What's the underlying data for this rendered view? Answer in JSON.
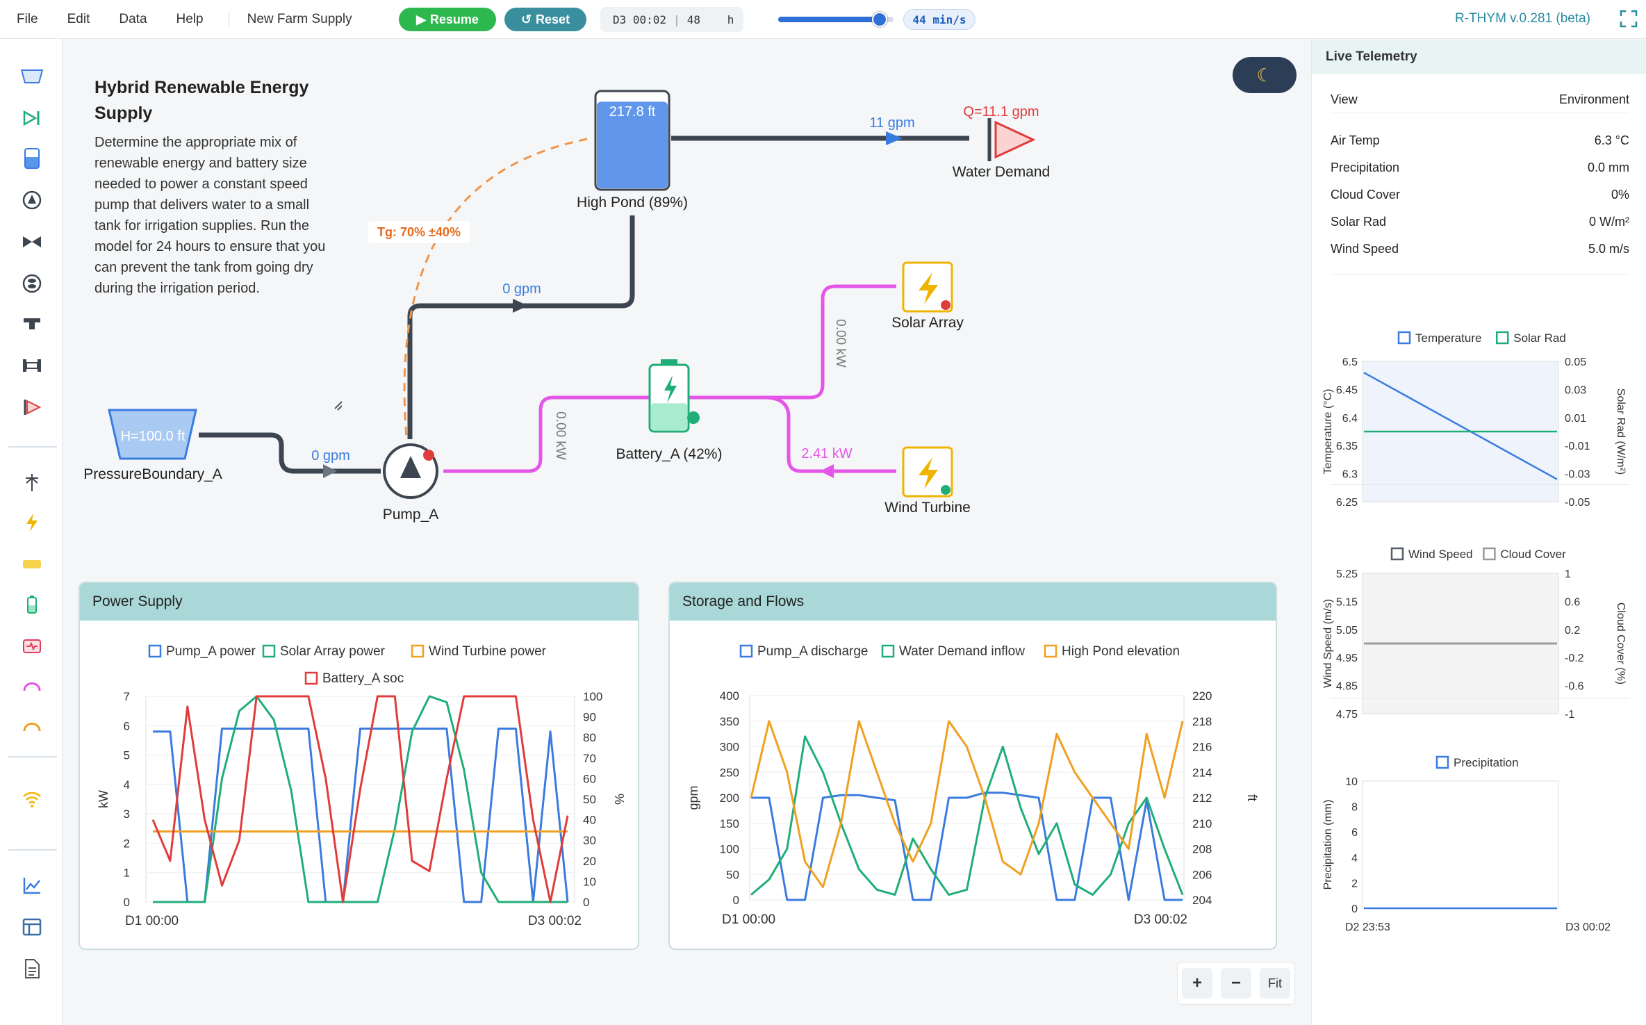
{
  "menu": {
    "file": "File",
    "edit": "Edit",
    "data": "Data",
    "help": "Help"
  },
  "model_name": "New Farm Supply",
  "controls": {
    "resume": "Resume",
    "reset": "Reset",
    "clock": "D3 00:02",
    "duration": "48",
    "duration_unit": "h",
    "speed": "44 min/s",
    "speed_fraction": 0.88
  },
  "version": "R-THYM v.0.281 (beta)",
  "description": {
    "title": "Hybrid Renewable Energy Supply",
    "body": "Determine the appropriate mix of renewable energy and battery size needed to power a constant speed pump that delivers water to a small tank for irrigation supplies. Run the model for 24 hours to ensure that you can prevent the tank from going dry during the irrigation period."
  },
  "schematic": {
    "pressure_boundary": {
      "name": "PressureBoundary_A",
      "head": "H=100.0 ft"
    },
    "pump": {
      "name": "Pump_A"
    },
    "pond": {
      "name": "High Pond (89%)",
      "level": "217.8 ft",
      "fill": 0.89
    },
    "battery": {
      "name": "Battery_A (42%)",
      "fill": 0.42
    },
    "solar": {
      "name": "Solar Array"
    },
    "wind": {
      "name": "Wind Turbine"
    },
    "demand": {
      "name": "Water Demand",
      "q": "Q=11.1 gpm"
    },
    "flows": {
      "inlet": "0 gpm",
      "pump_out": "0 gpm",
      "demand": "11 gpm",
      "solar_kw": "0.00 kW",
      "battery_kw": "0.00 kW",
      "wind_kw": "2.41 kW"
    },
    "target": "Tg: 70% ±40%"
  },
  "power_panel": {
    "title": "Power Supply",
    "legend": [
      "Pump_A power",
      "Solar Array power",
      "Wind Turbine power",
      "Battery_A soc"
    ],
    "y_left_ticks": [
      "7",
      "6",
      "5",
      "4",
      "3",
      "2",
      "1",
      "0"
    ],
    "y_right_ticks": [
      "100",
      "90",
      "80",
      "70",
      "60",
      "50",
      "40",
      "30",
      "20",
      "10",
      "0"
    ],
    "y_left_label": "kW",
    "y_right_label": "%",
    "x_start": "D1 00:00",
    "x_end": "D3 00:02"
  },
  "storage_panel": {
    "title": "Storage and Flows",
    "legend": [
      "Pump_A discharge",
      "Water Demand inflow",
      "High Pond elevation"
    ],
    "y_left_ticks": [
      "400",
      "350",
      "300",
      "250",
      "200",
      "150",
      "100",
      "50",
      "0"
    ],
    "y_right_ticks": [
      "220",
      "218",
      "216",
      "214",
      "212",
      "210",
      "208",
      "206",
      "204"
    ],
    "y_left_label": "gpm",
    "y_right_label": "ft",
    "x_start": "D1 00:00",
    "x_end": "D3 00:02"
  },
  "telemetry": {
    "title": "Live Telemetry",
    "view_label": "View",
    "view_value": "Environment",
    "rows": [
      {
        "label": "Air Temp",
        "value": "6.3 °C"
      },
      {
        "label": "Precipitation",
        "value": "0.0 mm"
      },
      {
        "label": "Cloud Cover",
        "value": "0%"
      },
      {
        "label": "Solar Rad",
        "value": "0 W/m²"
      },
      {
        "label": "Wind Speed",
        "value": "5.0 m/s"
      }
    ],
    "chart1": {
      "legend": [
        "Temperature",
        "Solar Rad"
      ],
      "y_left": [
        "6.5",
        "6.45",
        "6.4",
        "6.35",
        "6.3",
        "6.25"
      ],
      "y_right": [
        "0.05",
        "0.03",
        "0.01",
        "-0.01",
        "-0.03",
        "-0.05"
      ],
      "y_left_label": "Temperature (°C)",
      "y_right_label": "Solar Rad (W/m²)"
    },
    "chart2": {
      "legend": [
        "Wind Speed",
        "Cloud Cover"
      ],
      "y_left": [
        "5.25",
        "5.15",
        "5.05",
        "4.95",
        "4.85",
        "4.75"
      ],
      "y_right": [
        "1",
        "0.6",
        "0.2",
        "-0.2",
        "-0.6",
        "-1"
      ],
      "y_left_label": "Wind Speed (m/s)",
      "y_right_label": "Cloud Cover (%)"
    },
    "chart3": {
      "legend": [
        "Precipitation"
      ],
      "y_left": [
        "10",
        "8",
        "6",
        "4",
        "2",
        "0"
      ],
      "y_left_label": "Precipitation (mm)",
      "x_start": "D2 23:53",
      "x_end": "D3 00:02"
    }
  },
  "zoom": {
    "plus": "+",
    "minus": "−",
    "fit": "Fit"
  },
  "colors": {
    "pump_power": "#3a7be0",
    "solar_power": "#1fae78",
    "wind_power": "#f0a020",
    "battery_soc": "#e03c3c",
    "pipe": "#3d4550",
    "power_line": "#e455e8",
    "brand_green": "#2db84d",
    "brand_teal": "#3a8f9f"
  },
  "chart_data": [
    {
      "type": "line",
      "title": "Power Supply",
      "x_range": [
        "D1 00:00",
        "D3 00:02"
      ],
      "ylim_left": [
        0,
        7
      ],
      "ylim_right": [
        0,
        100
      ],
      "series": [
        {
          "name": "Pump_A power",
          "axis": "left",
          "values": [
            5.8,
            5.8,
            0,
            0,
            5.9,
            5.9,
            5.9,
            5.9,
            5.9,
            5.9,
            0,
            0,
            5.9,
            5.9,
            5.9,
            5.9,
            5.9,
            5.9,
            0,
            0,
            5.9,
            5.9,
            0,
            5.8,
            0
          ]
        },
        {
          "name": "Solar Array power",
          "axis": "left",
          "values": [
            0,
            0,
            0,
            0,
            4.2,
            6.5,
            7,
            6.2,
            3.8,
            0,
            0,
            0,
            0,
            0,
            2.5,
            5.8,
            7,
            6.8,
            4.5,
            1,
            0,
            0,
            0,
            0,
            0
          ]
        },
        {
          "name": "Wind Turbine power",
          "axis": "left",
          "values": [
            2.4,
            2.4,
            2.4,
            2.4,
            2.4,
            2.4,
            2.4,
            2.4,
            2.4,
            2.4,
            2.4,
            2.4,
            2.4,
            2.4,
            2.4,
            2.4,
            2.4,
            2.4,
            2.4,
            2.4,
            2.4,
            2.4,
            2.4,
            2.4,
            2.4
          ]
        },
        {
          "name": "Battery_A soc",
          "axis": "right",
          "values": [
            40,
            20,
            95,
            40,
            8,
            30,
            100,
            100,
            100,
            100,
            60,
            0,
            55,
            100,
            100,
            20,
            15,
            60,
            100,
            100,
            100,
            100,
            40,
            0,
            42
          ]
        }
      ]
    },
    {
      "type": "line",
      "title": "Storage and Flows",
      "x_range": [
        "D1 00:00",
        "D3 00:02"
      ],
      "ylim_left": [
        0,
        400
      ],
      "ylim_right": [
        204,
        220
      ],
      "series": [
        {
          "name": "Pump_A discharge",
          "axis": "left",
          "values": [
            200,
            200,
            0,
            0,
            200,
            205,
            205,
            200,
            195,
            0,
            0,
            200,
            200,
            210,
            210,
            205,
            200,
            0,
            0,
            200,
            200,
            0,
            195,
            0,
            0
          ]
        },
        {
          "name": "Water Demand inflow",
          "axis": "left",
          "values": [
            10,
            40,
            100,
            320,
            250,
            150,
            60,
            20,
            10,
            120,
            60,
            10,
            20,
            200,
            300,
            180,
            90,
            150,
            30,
            10,
            50,
            150,
            200,
            100,
            10
          ]
        },
        {
          "name": "High Pond elevation",
          "axis": "right",
          "values": [
            212,
            218,
            214,
            207,
            205,
            210,
            218,
            214,
            210,
            207,
            210,
            218,
            216,
            212,
            207,
            206,
            210,
            217,
            214,
            212,
            210,
            208,
            217,
            212,
            218
          ]
        }
      ]
    },
    {
      "type": "line",
      "title": "Temperature / Solar Rad",
      "x_range": [
        "D2 23:53",
        "D3 00:02"
      ],
      "ylim_left": [
        6.25,
        6.5
      ],
      "ylim_right": [
        -0.05,
        0.05
      ],
      "series": [
        {
          "name": "Temperature",
          "axis": "left",
          "values": [
            6.48,
            6.29
          ]
        },
        {
          "name": "Solar Rad",
          "axis": "right",
          "values": [
            0,
            0
          ]
        }
      ]
    },
    {
      "type": "line",
      "title": "Wind Speed / Cloud Cover",
      "x_range": [
        "D2 23:53",
        "D3 00:02"
      ],
      "ylim_left": [
        4.75,
        5.25
      ],
      "ylim_right": [
        -1,
        1
      ],
      "series": [
        {
          "name": "Wind Speed",
          "axis": "left",
          "values": [
            5.0,
            5.0
          ]
        },
        {
          "name": "Cloud Cover",
          "axis": "right",
          "values": [
            0,
            0
          ]
        }
      ]
    },
    {
      "type": "line",
      "title": "Precipitation",
      "x_range": [
        "D2 23:53",
        "D3 00:02"
      ],
      "ylim_left": [
        0,
        10
      ],
      "series": [
        {
          "name": "Precipitation",
          "axis": "left",
          "values": [
            0,
            0
          ]
        }
      ]
    }
  ]
}
